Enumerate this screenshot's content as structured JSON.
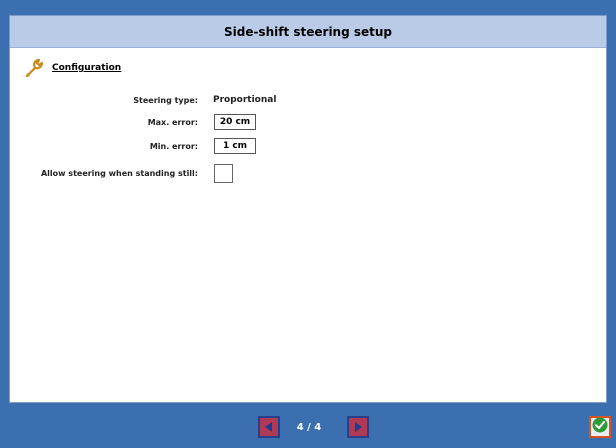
{
  "window": {
    "title": "Side-shift steering setup"
  },
  "section": {
    "label": "Configuration",
    "icon": "wrench-icon"
  },
  "fields": {
    "steering_type": {
      "label": "Steering type:",
      "value": "Proportional"
    },
    "max_error": {
      "label": "Max. error:",
      "value": "20 cm"
    },
    "min_error": {
      "label": "Min. error:",
      "value": "1 cm"
    },
    "allow_standing": {
      "label": "Allow steering when standing still:",
      "checked": false
    }
  },
  "footer": {
    "page_indicator": "4 / 4",
    "prev_icon": "arrow-left-icon",
    "next_icon": "arrow-right-icon",
    "ok_icon": "check-icon"
  },
  "colors": {
    "background": "#3b6fb0",
    "title_bar": "#b9cbe6",
    "nav_button": "#b03a56",
    "ok_green": "#2e9a3a"
  }
}
